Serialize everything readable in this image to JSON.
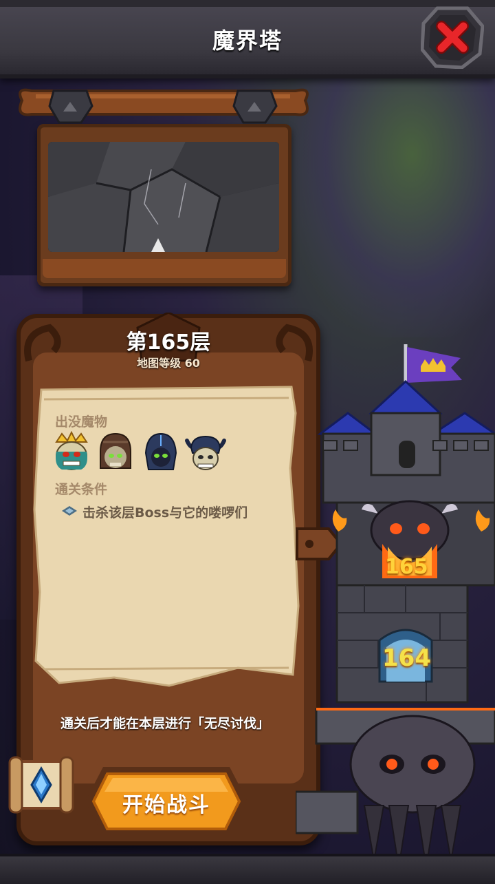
{
  "header": {
    "title": "魔界塔",
    "close_icon": "red-x-icon"
  },
  "floor": {
    "title": "第165层",
    "map_level": "地图等级 60"
  },
  "monsters": {
    "label": "出没魔物",
    "icons": [
      "crowned-skull-icon",
      "hooded-skull-icon",
      "dark-helmet-skull-icon",
      "horned-skull-icon"
    ]
  },
  "clear_condition": {
    "label": "通关条件",
    "text": "击杀该层Boss与它的喽啰们",
    "icon": "diamond-bullet-icon"
  },
  "note": "通关后才能在本层进行「无尽讨伐」",
  "actions": {
    "start_battle": "开始战斗",
    "scroll_icon": "blue-gem-scroll-icon"
  },
  "tower": {
    "current_floor": "165",
    "previous_floor": "164"
  },
  "colors": {
    "accent_orange": "#f29a1d",
    "wood": "#7b4424",
    "parchment": "#ead7b0"
  }
}
